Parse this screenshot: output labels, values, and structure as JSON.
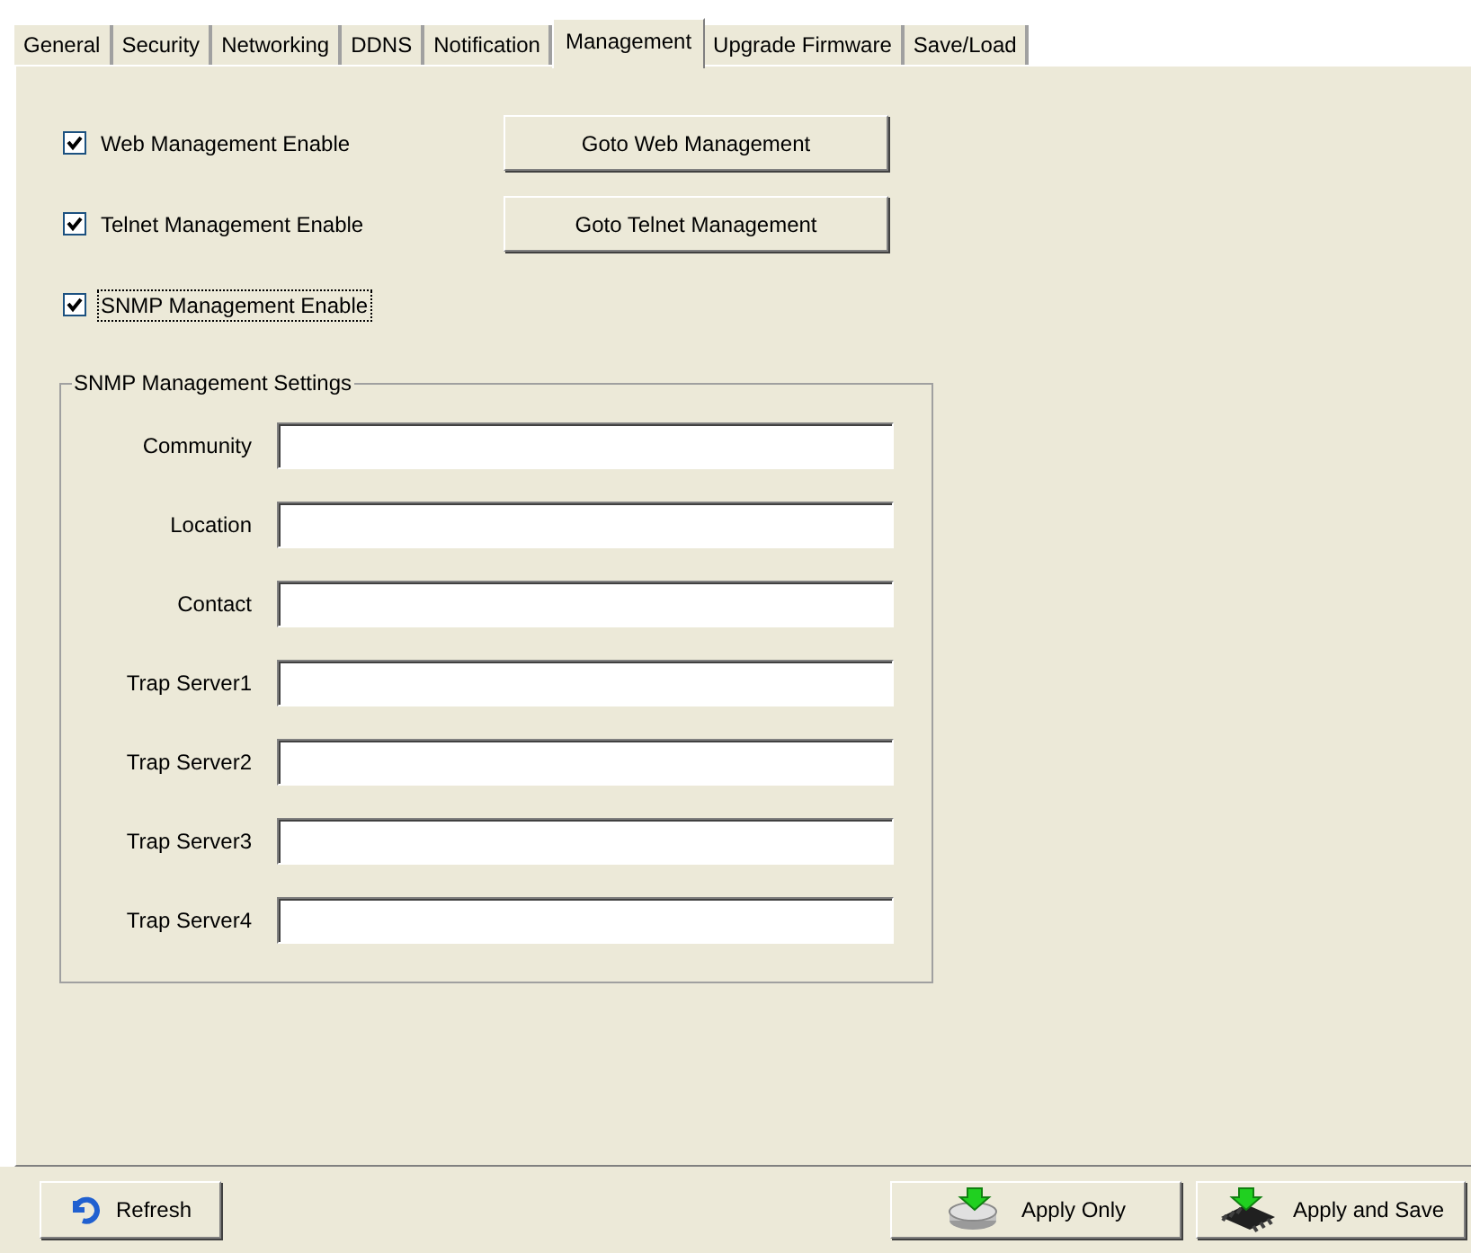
{
  "tabs": [
    {
      "label": "General",
      "selected": false
    },
    {
      "label": "Security",
      "selected": false
    },
    {
      "label": "Networking",
      "selected": false
    },
    {
      "label": "DDNS",
      "selected": false
    },
    {
      "label": "Notification",
      "selected": false
    },
    {
      "label": "Management",
      "selected": true
    },
    {
      "label": "Upgrade Firmware",
      "selected": false
    },
    {
      "label": "Save/Load",
      "selected": false
    }
  ],
  "options": [
    {
      "label": "Web Management Enable",
      "checked": true,
      "focused": false,
      "button": "Goto Web Management"
    },
    {
      "label": "Telnet Management Enable",
      "checked": true,
      "focused": false,
      "button": "Goto Telnet Management"
    },
    {
      "label": "SNMP Management Enable",
      "checked": true,
      "focused": true
    }
  ],
  "snmp_settings": {
    "title": "SNMP Management Settings",
    "fields": [
      {
        "label": "Community"
      },
      {
        "label": "Location"
      },
      {
        "label": "Contact"
      },
      {
        "label": "Trap Server1"
      },
      {
        "label": "Trap Server2"
      },
      {
        "label": "Trap Server3"
      },
      {
        "label": "Trap Server4"
      }
    ]
  },
  "footer_buttons": [
    {
      "kind": "refresh",
      "label": "Refresh"
    },
    {
      "kind": "apply",
      "label": "Apply Only"
    },
    {
      "kind": "save",
      "label": "Apply and Save"
    }
  ]
}
